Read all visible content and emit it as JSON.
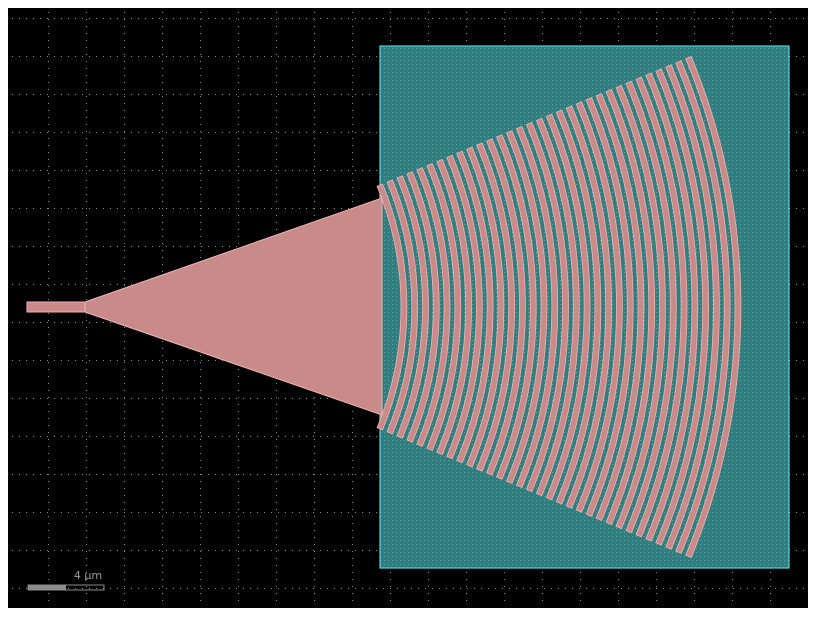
{
  "scale_bar": {
    "label": "4 μm"
  },
  "colors": {
    "background": "#000000",
    "grid_dots": "#8a8a8a",
    "waveguide_fill": "#c98a8a",
    "waveguide_stroke": "#f2b3b3",
    "region_fill": "#2f7f80",
    "region_stroke": "#4fd6dc",
    "scale_bar": "#8c8c8c"
  },
  "grating": {
    "tooth_count": 32
  }
}
